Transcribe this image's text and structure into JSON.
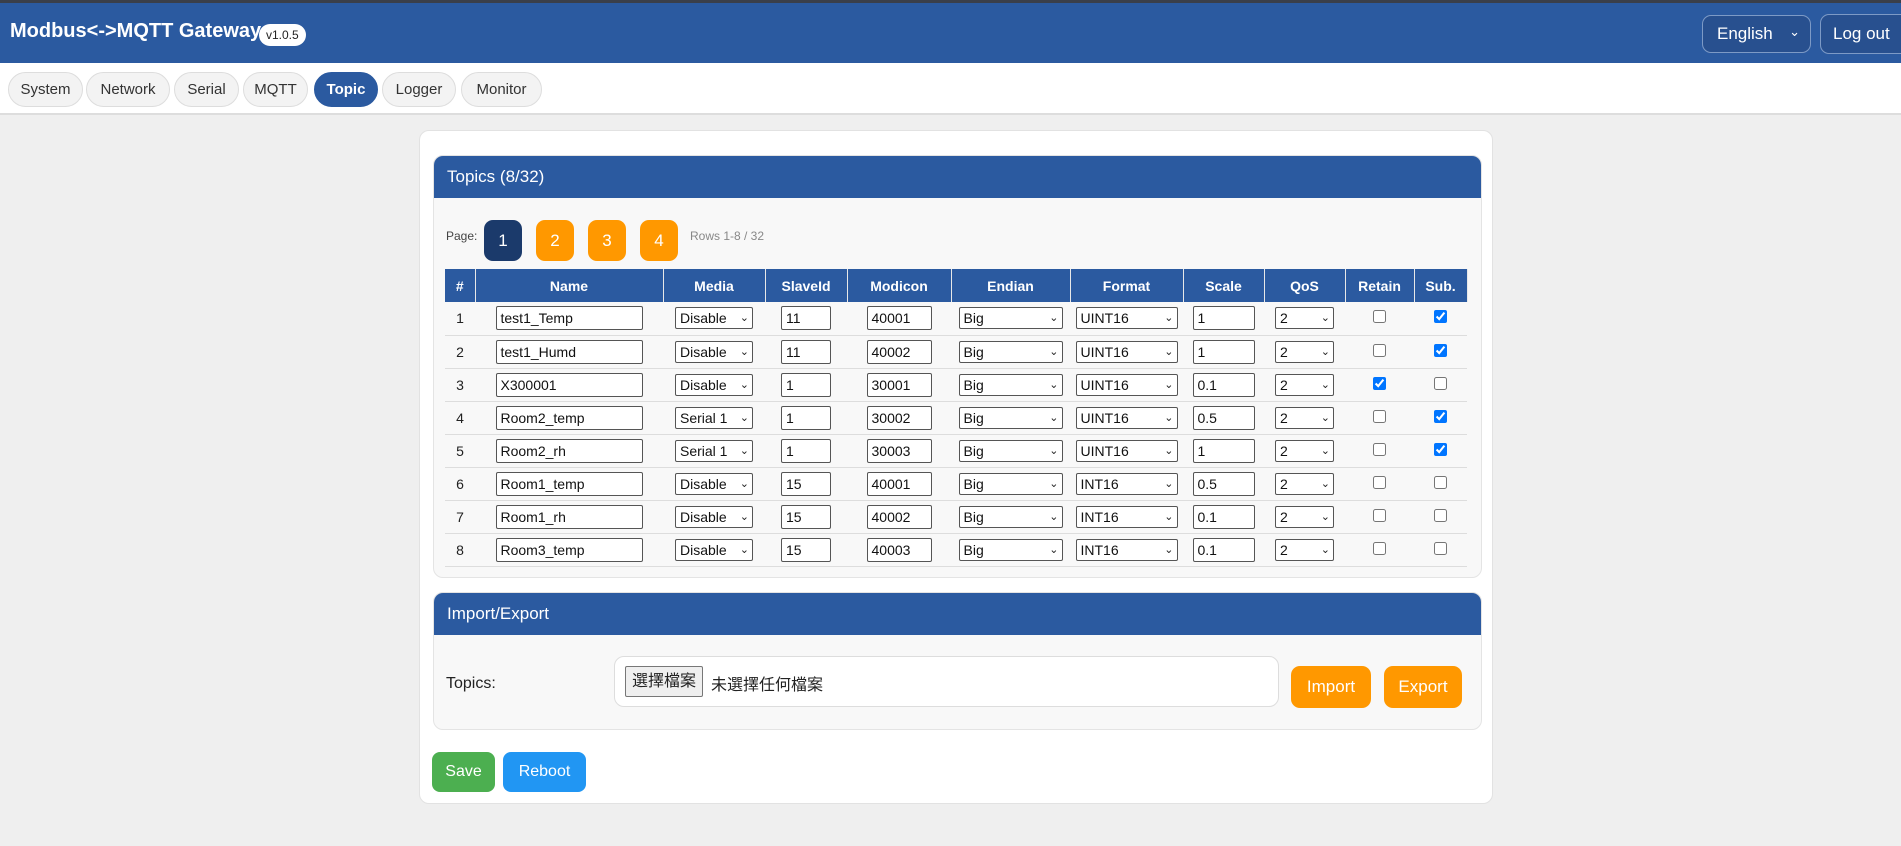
{
  "header": {
    "title": "Modbus<->MQTT Gateway",
    "version": "v1.0.5",
    "language": "English",
    "logout": "Log out"
  },
  "nav": {
    "tabs": [
      "System",
      "Network",
      "Serial",
      "MQTT",
      "Topic",
      "Logger",
      "Monitor"
    ],
    "active": "Topic"
  },
  "topics": {
    "title": "Topics (8/32)",
    "page_label": "Page:",
    "pages": [
      "1",
      "2",
      "3",
      "4"
    ],
    "current_page": "1",
    "rows_info": "Rows 1-8 / 32",
    "columns": [
      "#",
      "Name",
      "Media",
      "SlaveId",
      "Modicon",
      "Endian",
      "Format",
      "Scale",
      "QoS",
      "Retain",
      "Sub."
    ],
    "rows": [
      {
        "n": "1",
        "name": "test1_Temp",
        "media": "Disable",
        "slave": "11",
        "modicon": "40001",
        "endian": "Big",
        "format": "UINT16",
        "scale": "1",
        "qos": "2",
        "retain": false,
        "sub": true
      },
      {
        "n": "2",
        "name": "test1_Humd",
        "media": "Disable",
        "slave": "11",
        "modicon": "40002",
        "endian": "Big",
        "format": "UINT16",
        "scale": "1",
        "qos": "2",
        "retain": false,
        "sub": true
      },
      {
        "n": "3",
        "name": "X300001",
        "media": "Disable",
        "slave": "1",
        "modicon": "30001",
        "endian": "Big",
        "format": "UINT16",
        "scale": "0.1",
        "qos": "2",
        "retain": true,
        "sub": false
      },
      {
        "n": "4",
        "name": "Room2_temp",
        "media": "Serial 1",
        "slave": "1",
        "modicon": "30002",
        "endian": "Big",
        "format": "UINT16",
        "scale": "0.5",
        "qos": "2",
        "retain": false,
        "sub": true
      },
      {
        "n": "5",
        "name": "Room2_rh",
        "media": "Serial 1",
        "slave": "1",
        "modicon": "30003",
        "endian": "Big",
        "format": "UINT16",
        "scale": "1",
        "qos": "2",
        "retain": false,
        "sub": true
      },
      {
        "n": "6",
        "name": "Room1_temp",
        "media": "Disable",
        "slave": "15",
        "modicon": "40001",
        "endian": "Big",
        "format": "INT16",
        "scale": "0.5",
        "qos": "2",
        "retain": false,
        "sub": false
      },
      {
        "n": "7",
        "name": "Room1_rh",
        "media": "Disable",
        "slave": "15",
        "modicon": "40002",
        "endian": "Big",
        "format": "INT16",
        "scale": "0.1",
        "qos": "2",
        "retain": false,
        "sub": false
      },
      {
        "n": "8",
        "name": "Room3_temp",
        "media": "Disable",
        "slave": "15",
        "modicon": "40003",
        "endian": "Big",
        "format": "INT16",
        "scale": "0.1",
        "qos": "2",
        "retain": false,
        "sub": false
      }
    ]
  },
  "import_export": {
    "title": "Import/Export",
    "label": "Topics:",
    "choose_file": "選擇檔案",
    "no_file": "未選擇任何檔案",
    "import": "Import",
    "export": "Export"
  },
  "actions": {
    "save": "Save",
    "reboot": "Reboot"
  },
  "colors": {
    "primary": "#2b5aa0",
    "orange": "#ff9800",
    "save": "#4caf50",
    "reboot": "#2196f3",
    "current_page": "#1b3a6b"
  }
}
